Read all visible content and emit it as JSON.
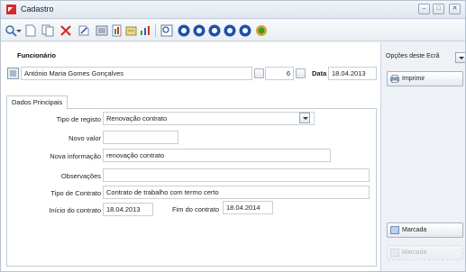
{
  "window": {
    "title": "Cadastro"
  },
  "header": {
    "section_title": "Funcionário",
    "employee_name": "António Maria Gomes Gonçalves",
    "employee_number": "6",
    "date_label": "Data",
    "date_value": "18.04.2013"
  },
  "tabs": [
    {
      "label": "Dados Principais"
    }
  ],
  "form": {
    "tipo_registo": {
      "label": "Tipo de registo",
      "value": "Renovação contrato"
    },
    "novo_valor": {
      "label": "Novo valor",
      "value": ""
    },
    "nova_informacao": {
      "label": "Nova informação",
      "value": "renovação contrato"
    },
    "observacoes": {
      "label": "Observações",
      "value": ""
    },
    "tipo_contrato": {
      "label": "Tipo de Contrato",
      "value": "Contrato de trabalho com termo certo"
    },
    "inicio_contrato": {
      "label": "Início do contrato",
      "value": "18.04.2013"
    },
    "fim_contrato": {
      "label": "Fim do contrato",
      "value": "18.04.2014"
    }
  },
  "side": {
    "options_label": "Opções deste Ecrã",
    "print_label": "Imprimir",
    "marked_label": "Marcada",
    "faded_label": "Marcada"
  },
  "icons": {
    "toolbar": [
      "search-icon",
      "new-icon",
      "copy-icon",
      "delete-icon",
      "edit-icon",
      "list-icon",
      "report-icon",
      "export-icon",
      "chart-icon",
      "preview-icon",
      "first-icon",
      "previous-icon",
      "next-icon",
      "last-icon",
      "refresh-icon",
      "web-icon"
    ]
  },
  "colors": {
    "accent": "#d42b2b",
    "nav_blue": "#1f4fa8",
    "green": "#3a9a3a"
  }
}
